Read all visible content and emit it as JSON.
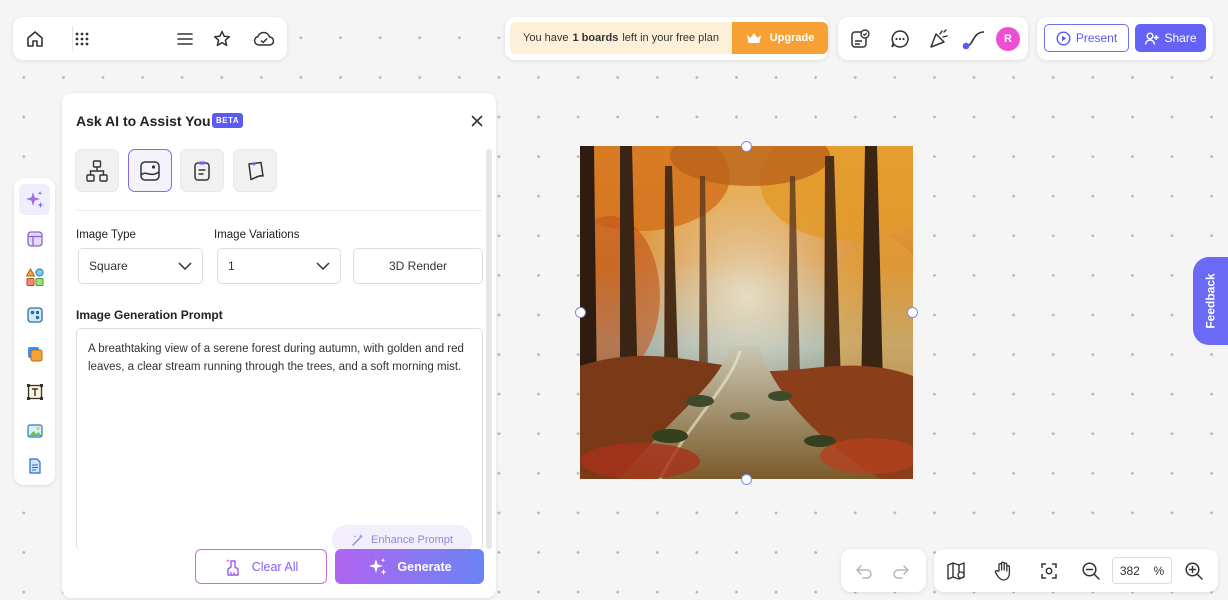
{
  "plan_bar": {
    "message_prefix": "You have",
    "boards_count": "1 boards",
    "message_suffix": "left in your free plan",
    "upgrade_label": "Upgrade"
  },
  "user": {
    "avatar_initial": "R"
  },
  "share_bar": {
    "present_label": "Present",
    "share_label": "Share"
  },
  "ai_panel": {
    "title": "Ask AI to Assist You",
    "badge": "BETA",
    "image_type_label": "Image Type",
    "image_type_value": "Square",
    "variations_label": "Image Variations",
    "variations_value": "1",
    "style_label": "3D Render",
    "prompt_label": "Image Generation Prompt",
    "prompt_text": "A breathtaking view of a serene forest during autumn, with golden and red leaves, a clear stream running through the trees, and a soft morning mist.",
    "enhance_label": "Enhance Prompt",
    "clear_label": "Clear All",
    "generate_label": "Generate"
  },
  "feedback_label": "Feedback",
  "zoom": {
    "value": "382",
    "unit": "%"
  },
  "colors": {
    "accent": "#6463f5",
    "upgrade": "#f7a033",
    "plan_bg": "#fdf0d8",
    "avatar": "#ec4fd1"
  },
  "icons": {
    "top_left": [
      "home-icon",
      "grid-icon",
      "menu-icon",
      "star-icon",
      "cloud-check-icon"
    ],
    "top_right": [
      "board-check-icon",
      "chat-icon",
      "celebrate-icon",
      "connector-icon"
    ],
    "side": [
      "ai-sparkle-icon",
      "template-icon",
      "shapes-icon",
      "components-icon",
      "sticky-note-icon",
      "text-icon",
      "image-icon",
      "document-icon"
    ],
    "modes": [
      "flowchart-mode-icon",
      "image-mode-icon",
      "note-mode-icon",
      "sticky-mode-icon"
    ],
    "bottom": [
      "undo-icon",
      "redo-icon",
      "map-icon",
      "hand-icon",
      "fit-screen-icon",
      "zoom-out-icon",
      "zoom-in-icon"
    ]
  }
}
